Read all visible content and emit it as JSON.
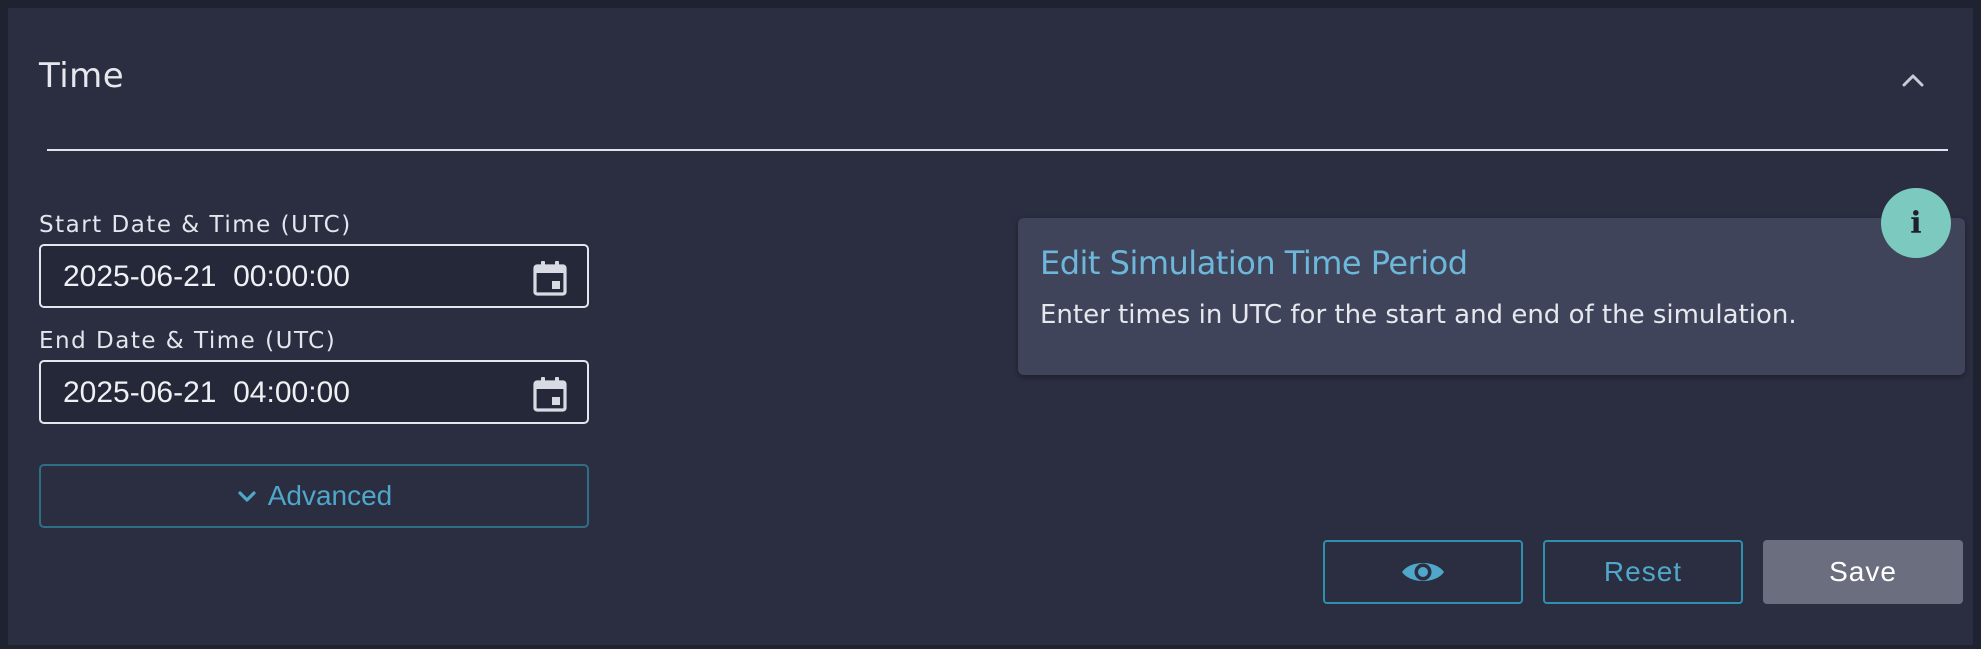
{
  "section": {
    "title": "Time",
    "collapse_icon": "chevron-up-icon"
  },
  "start": {
    "label": "Start Date & Time (UTC)",
    "value": "2025-06-21  00:00:00",
    "icon": "calendar-icon"
  },
  "end": {
    "label": "End Date & Time (UTC)",
    "value": "2025-06-21  04:00:00",
    "icon": "calendar-icon"
  },
  "advanced": {
    "label": "Advanced",
    "icon": "chevron-down-icon"
  },
  "info": {
    "badge": "i",
    "title": "Edit Simulation Time Period",
    "text": "Enter times in UTC for the start and end of the simulation."
  },
  "actions": {
    "preview_icon": "eye-icon",
    "reset_label": "Reset",
    "save_label": "Save"
  },
  "colors": {
    "background": "#2a2e40",
    "accent": "#4fa7c9",
    "info_badge": "#7ccabf",
    "info_card": "#40445a",
    "save_button": "#6b6e7e"
  }
}
